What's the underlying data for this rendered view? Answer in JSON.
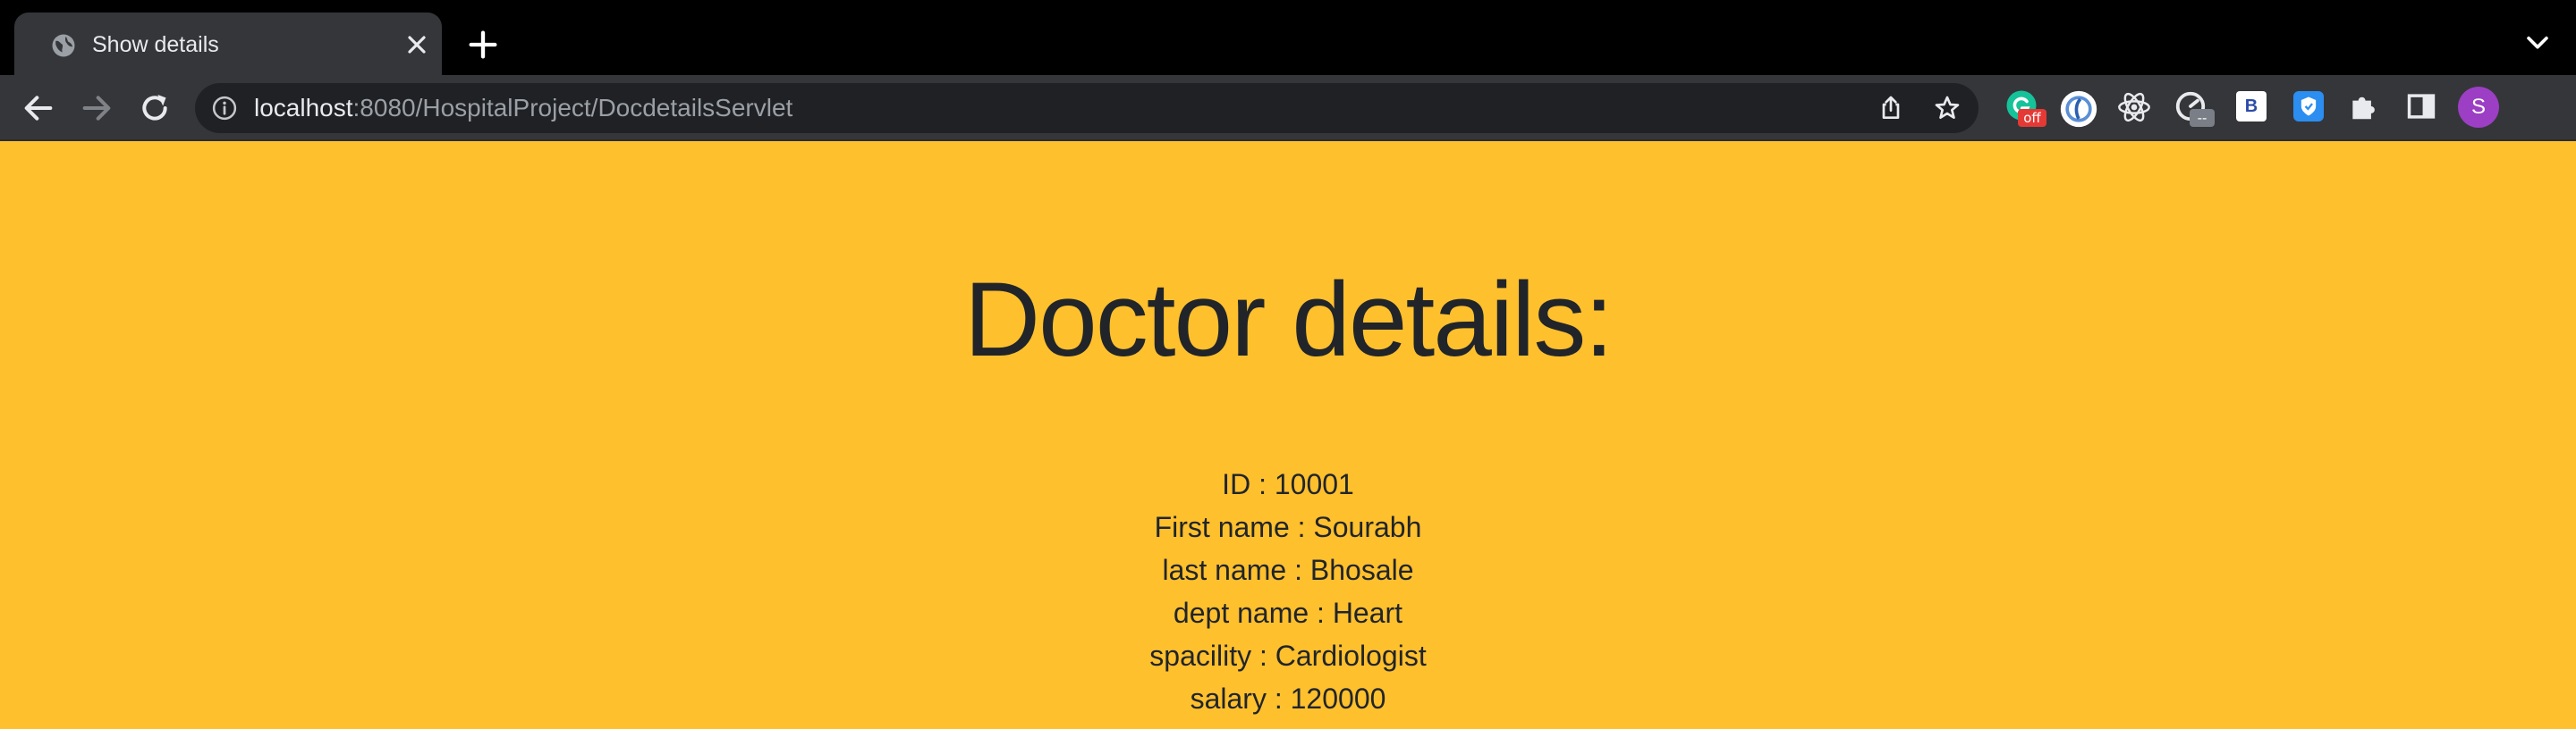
{
  "tab": {
    "title": "Show details",
    "favicon_icon": "globe-icon",
    "close_icon": "close-icon"
  },
  "tabstrip": {
    "new_tab_icon": "plus-icon",
    "tab_search_icon": "chevron-down-icon"
  },
  "toolbar": {
    "back_icon": "back-arrow-icon",
    "forward_icon": "forward-arrow-icon",
    "reload_icon": "reload-icon",
    "url_host": "localhost",
    "url_rest": ":8080/HospitalProject/DocdetailsServlet",
    "site_info_icon": "info-icon",
    "share_icon": "share-icon",
    "bookmark_icon": "star-icon"
  },
  "extensions": [
    {
      "name": "grammarly-icon",
      "badge": "off",
      "badge_color": "#e53935"
    },
    {
      "name": "ext-circle-icon"
    },
    {
      "name": "react-devtools-icon"
    },
    {
      "name": "dashboard-icon",
      "badge": "--",
      "badge_color": "#7a7f87"
    },
    {
      "name": "ext-b-icon",
      "label": "B"
    },
    {
      "name": "shield-icon"
    },
    {
      "name": "puzzle-icon"
    },
    {
      "name": "side-panel-icon"
    }
  ],
  "profile": {
    "initial": "S",
    "color": "#9c3fc4"
  },
  "colors": {
    "page_background": "#ffc02e",
    "text": "#212529",
    "chrome_dark": "#35363a"
  },
  "page": {
    "heading": "Doctor details:",
    "details": [
      "ID : 10001",
      "First name : Sourabh",
      "last name : Bhosale",
      "dept name : Heart",
      "spacility : Cardiologist",
      "salary : 120000"
    ]
  }
}
